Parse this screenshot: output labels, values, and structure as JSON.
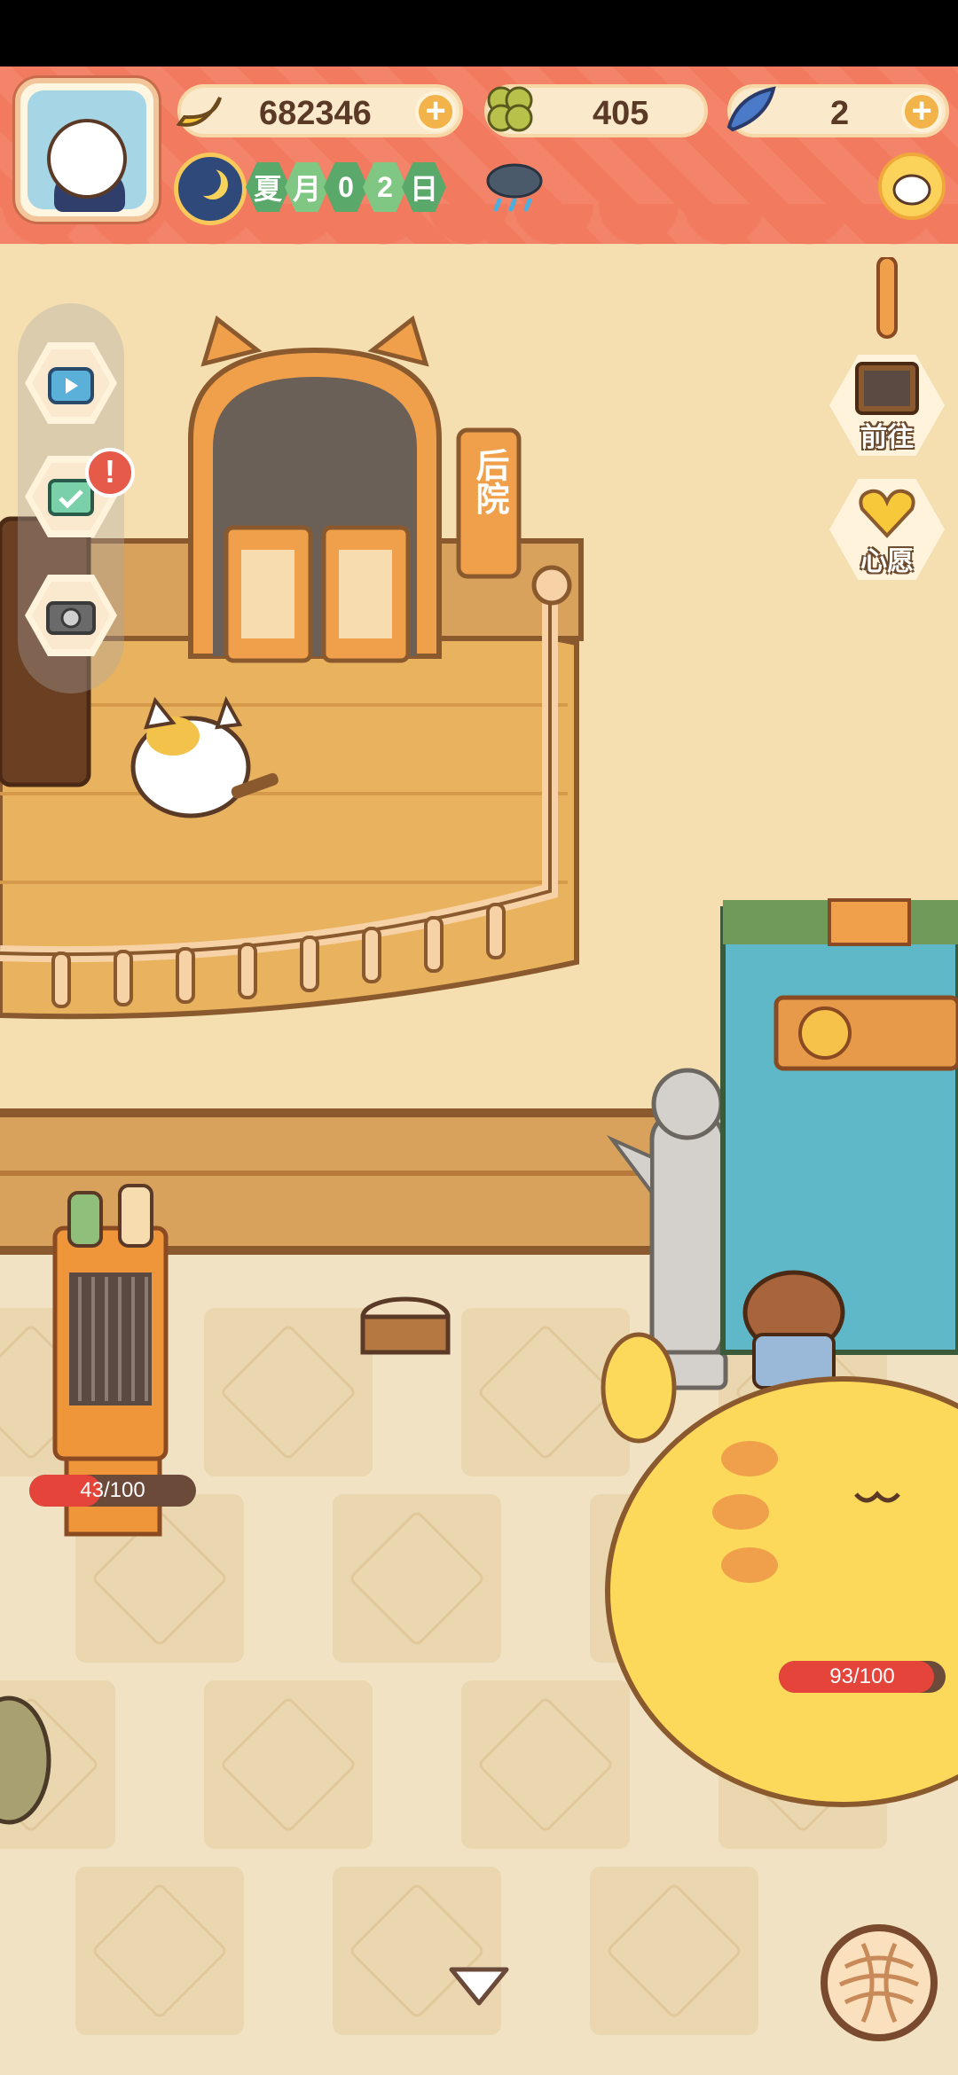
{
  "hud": {
    "bananas": "682346",
    "clovers": "405",
    "fish": "2",
    "date_chips": [
      "夏",
      "月",
      "0",
      "2",
      "日"
    ]
  },
  "nav_buttons": {
    "goto_label": "前往",
    "wish_label": "心愿"
  },
  "scene": {
    "door_sign": "后院",
    "bars": [
      {
        "text": "43/100",
        "fraction": 0.43
      },
      {
        "text": "93/100",
        "fraction": 0.93
      }
    ]
  },
  "icons": {
    "banana": "banana-icon",
    "clover": "clover-icon",
    "fish": "fish-icon",
    "weather": "rain-cloud-icon",
    "video": "tv-play-icon",
    "task": "checklist-icon",
    "camera": "camera-icon",
    "yarn": "yarn-ball-icon"
  },
  "colors": {
    "hud": "#f27a5e",
    "alert": "#e65a4a",
    "bar_fill": "#e4443a",
    "date_green": "#5aa86a"
  }
}
